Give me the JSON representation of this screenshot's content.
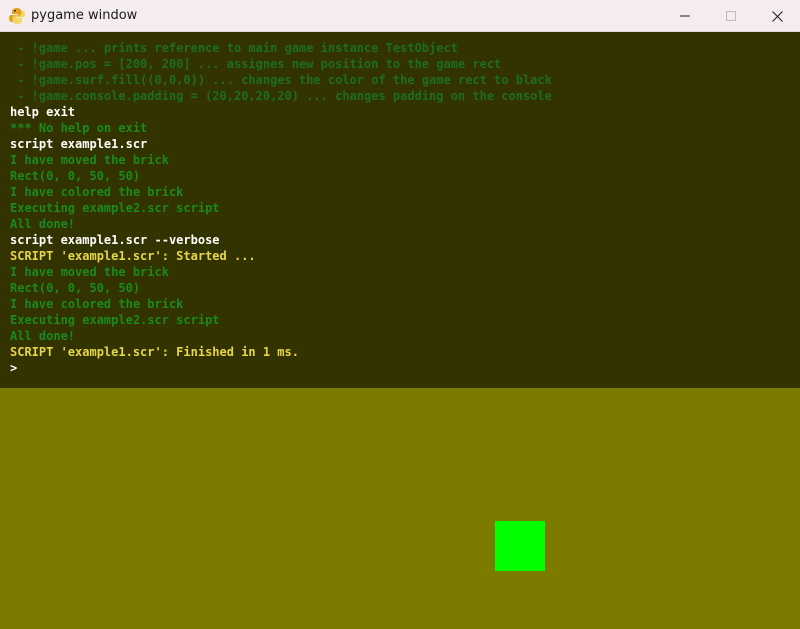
{
  "window": {
    "title": "pygame window",
    "icon": "pygame-snake-icon",
    "controls": [
      "minimize-icon",
      "maximize-icon",
      "close-icon"
    ]
  },
  "console": {
    "background": "#333300",
    "lines": [
      {
        "text": " - !game ... prints reference to main game instance TestObject",
        "kind": "help"
      },
      {
        "text": " - !game.pos = [200, 200] ... assignes new position to the game rect",
        "kind": "help"
      },
      {
        "text": " - !game.surf.fill((0,0,0)) ... changes the color of the game rect to black",
        "kind": "help"
      },
      {
        "text": " - !game.console.padding = (20,20,20,20) ... changes padding on the console",
        "kind": "help"
      },
      {
        "text": "help exit",
        "kind": "cmd"
      },
      {
        "text": "*** No help on exit",
        "kind": "out"
      },
      {
        "text": "script example1.scr",
        "kind": "cmd"
      },
      {
        "text": "I have moved the brick",
        "kind": "out"
      },
      {
        "text": "Rect(0, 0, 50, 50)",
        "kind": "out"
      },
      {
        "text": "I have colored the brick",
        "kind": "out"
      },
      {
        "text": "Executing example2.scr script",
        "kind": "out"
      },
      {
        "text": "All done!",
        "kind": "out"
      },
      {
        "text": "script example1.scr --verbose",
        "kind": "cmd"
      },
      {
        "text": "SCRIPT 'example1.scr': Started ...",
        "kind": "script"
      },
      {
        "text": "I have moved the brick",
        "kind": "out"
      },
      {
        "text": "Rect(0, 0, 50, 50)",
        "kind": "out"
      },
      {
        "text": "I have colored the brick",
        "kind": "out"
      },
      {
        "text": "Executing example2.scr script",
        "kind": "out"
      },
      {
        "text": "All done!",
        "kind": "out"
      },
      {
        "text": "SCRIPT 'example1.scr': Finished in 1 ms.",
        "kind": "script"
      }
    ],
    "prompt": ">"
  },
  "game": {
    "background": "#7b7b00",
    "brick_color": "#00ff00"
  }
}
